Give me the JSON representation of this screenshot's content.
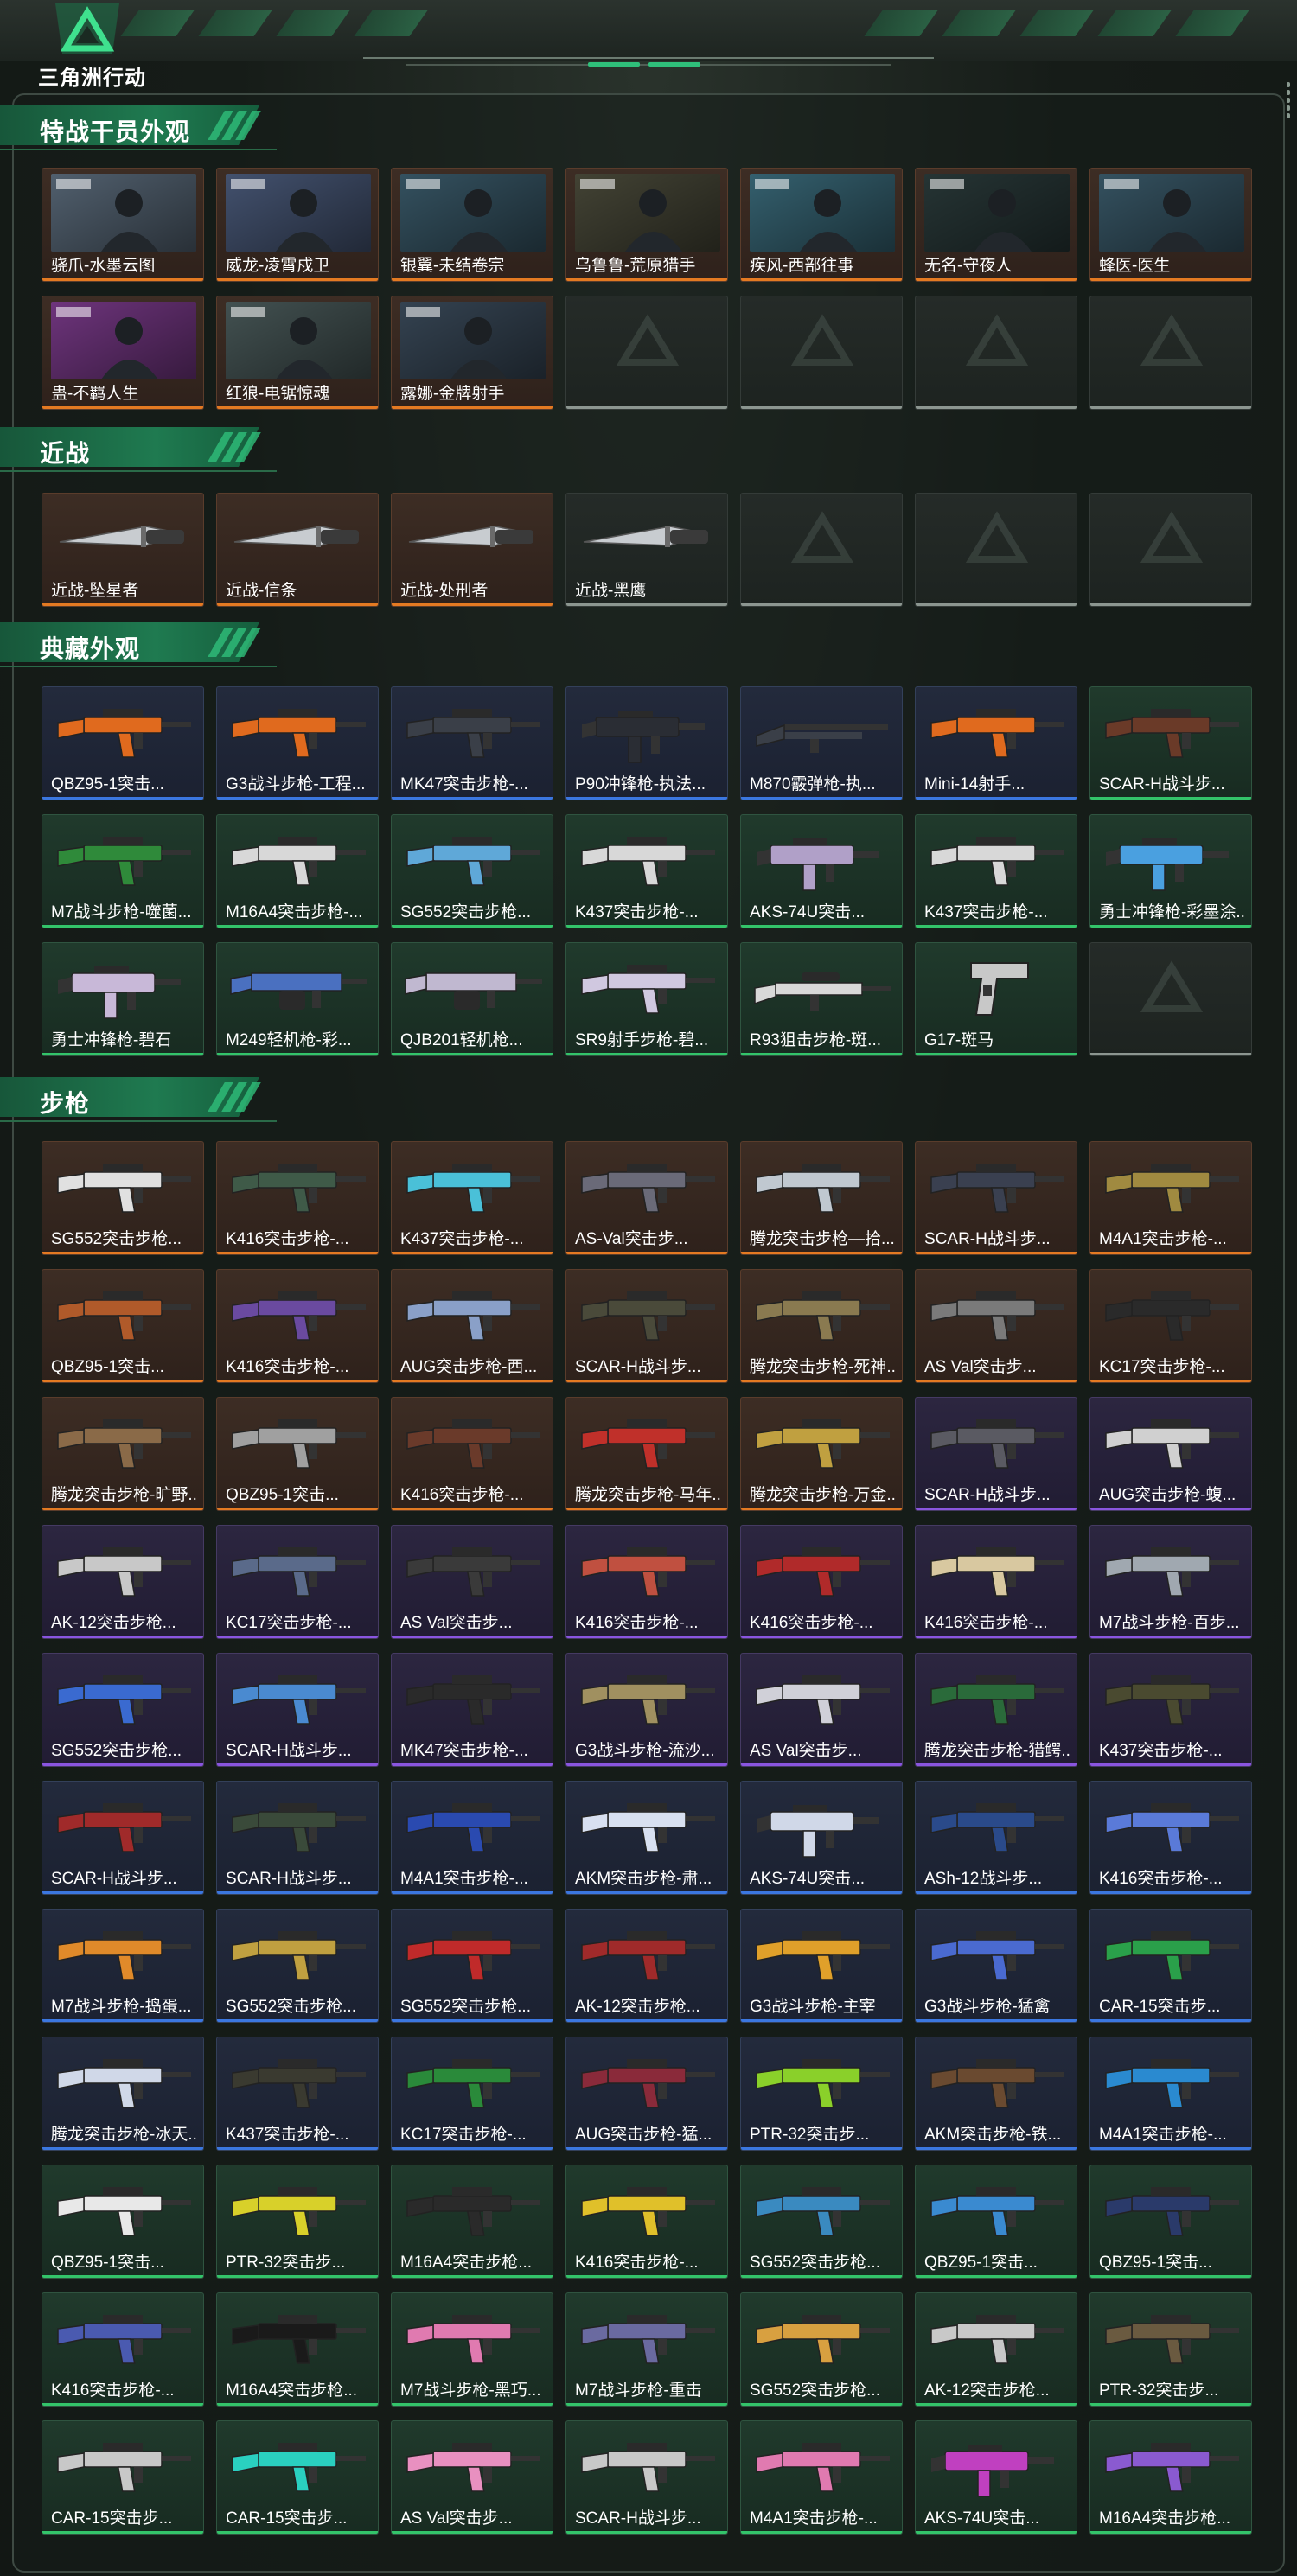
{
  "app": {
    "logo_text": "三角洲行动"
  },
  "colors": {
    "orange": "#e47a22",
    "blue": "#3b77e0",
    "purple": "#8a55e0",
    "green": "#33c46a",
    "accent": "#2fbf7a"
  },
  "sections": [
    {
      "title": "特战干员外观",
      "items": [
        {
          "name": "骁爪-水墨云图",
          "tier": "orange",
          "icon": "operator-portrait"
        },
        {
          "name": "威龙-凌霄戍卫",
          "tier": "orange",
          "icon": "operator-portrait"
        },
        {
          "name": "银翼-未结卷宗",
          "tier": "orange",
          "icon": "operator-portrait"
        },
        {
          "name": "乌鲁鲁-荒原猎手",
          "tier": "orange",
          "icon": "operator-portrait"
        },
        {
          "name": "疾风-西部往事",
          "tier": "orange",
          "icon": "operator-portrait"
        },
        {
          "name": "无名-守夜人",
          "tier": "orange",
          "icon": "operator-portrait"
        },
        {
          "name": "蜂医-医生",
          "tier": "orange",
          "icon": "operator-portrait"
        },
        {
          "name": "蛊-不羁人生",
          "tier": "orange",
          "icon": "operator-portrait"
        },
        {
          "name": "红狼-电锯惊魂",
          "tier": "orange",
          "icon": "operator-portrait"
        },
        {
          "name": "露娜-金牌射手",
          "tier": "orange",
          "icon": "operator-portrait"
        },
        {
          "name": "",
          "tier": "empty",
          "icon": "empty-slot"
        },
        {
          "name": "",
          "tier": "empty",
          "icon": "empty-slot"
        },
        {
          "name": "",
          "tier": "empty",
          "icon": "empty-slot"
        },
        {
          "name": "",
          "tier": "empty",
          "icon": "empty-slot"
        }
      ]
    },
    {
      "title": "近战",
      "items": [
        {
          "name": "近战-坠星者",
          "tier": "orange",
          "icon": "knife-icon"
        },
        {
          "name": "近战-信条",
          "tier": "orange",
          "icon": "knife-icon"
        },
        {
          "name": "近战-处刑者",
          "tier": "orange",
          "icon": "knife-icon"
        },
        {
          "name": "近战-黑鹰",
          "tier": "empty-dark",
          "icon": "knife-icon"
        },
        {
          "name": "",
          "tier": "empty",
          "icon": "empty-slot"
        },
        {
          "name": "",
          "tier": "empty",
          "icon": "empty-slot"
        },
        {
          "name": "",
          "tier": "empty",
          "icon": "empty-slot"
        }
      ]
    },
    {
      "title": "典藏外观",
      "items": [
        {
          "name": "QBZ95-1突击...",
          "tier": "blue",
          "icon": "rifle-icon",
          "tint": "#e06a1e"
        },
        {
          "name": "G3战斗步枪-工程...",
          "tier": "blue",
          "icon": "rifle-icon",
          "tint": "#e06a1e"
        },
        {
          "name": "MK47突击步枪-...",
          "tier": "blue",
          "icon": "rifle-icon",
          "tint": "#3a3f48"
        },
        {
          "name": "P90冲锋枪-执法...",
          "tier": "blue",
          "icon": "smg-icon",
          "tint": "#2a2d34"
        },
        {
          "name": "M870霰弹枪-执...",
          "tier": "blue",
          "icon": "shotgun-icon",
          "tint": "#3a3f48"
        },
        {
          "name": "Mini-14射手...",
          "tier": "blue",
          "icon": "rifle-icon",
          "tint": "#e06a1e"
        },
        {
          "name": "SCAR-H战斗步...",
          "tier": "green",
          "icon": "rifle-icon",
          "tint": "#6a3a28"
        },
        {
          "name": "M7战斗步枪-噬菌...",
          "tier": "green",
          "icon": "rifle-icon",
          "tint": "#2f8a3a"
        },
        {
          "name": "M16A4突击步枪-...",
          "tier": "green",
          "icon": "rifle-icon",
          "tint": "#d8d8d8"
        },
        {
          "name": "SG552突击步枪...",
          "tier": "green",
          "icon": "rifle-icon",
          "tint": "#5fa8d8"
        },
        {
          "name": "K437突击步枪-...",
          "tier": "green",
          "icon": "rifle-icon",
          "tint": "#d8d8d8"
        },
        {
          "name": "AKS-74U突击...",
          "tier": "green",
          "icon": "smg-icon",
          "tint": "#b0a0c8"
        },
        {
          "name": "K437突击步枪-...",
          "tier": "green",
          "icon": "rifle-icon",
          "tint": "#d8d8d8"
        },
        {
          "name": "勇士冲锋枪-彩墨涂...",
          "tier": "green",
          "icon": "smg-icon",
          "tint": "#4aa0e0"
        },
        {
          "name": "勇士冲锋枪-碧石",
          "tier": "green",
          "icon": "smg-icon",
          "tint": "#c8b8d8"
        },
        {
          "name": "M249轻机枪-彩...",
          "tier": "green",
          "icon": "lmg-icon",
          "tint": "#4a70c0"
        },
        {
          "name": "QJB201轻机枪...",
          "tier": "green",
          "icon": "lmg-icon",
          "tint": "#c0b8d0"
        },
        {
          "name": "SR9射手步枪-碧...",
          "tier": "green",
          "icon": "rifle-icon",
          "tint": "#d0c8e0"
        },
        {
          "name": "R93狙击步枪-斑...",
          "tier": "green",
          "icon": "sniper-icon",
          "tint": "#d8d8d8"
        },
        {
          "name": "G17-斑马",
          "tier": "green",
          "icon": "pistol-icon",
          "tint": "#c8c8c8"
        },
        {
          "name": "",
          "tier": "empty",
          "icon": "empty-slot"
        }
      ]
    },
    {
      "title": "步枪",
      "items": [
        {
          "name": "SG552突击步枪...",
          "tier": "orange",
          "icon": "rifle-icon",
          "tint": "#e0e0e0"
        },
        {
          "name": "K416突击步枪-...",
          "tier": "orange",
          "icon": "rifle-icon",
          "tint": "#3f5a48"
        },
        {
          "name": "K437突击步枪-...",
          "tier": "orange",
          "icon": "rifle-icon",
          "tint": "#4ac0d8"
        },
        {
          "name": "AS-Val突击步...",
          "tier": "orange",
          "icon": "rifle-icon",
          "tint": "#6a6a78"
        },
        {
          "name": "腾龙突击步枪—拾...",
          "tier": "orange",
          "icon": "rifle-icon",
          "tint": "#c0c8d0"
        },
        {
          "name": "SCAR-H战斗步...",
          "tier": "orange",
          "icon": "rifle-icon",
          "tint": "#3a4050"
        },
        {
          "name": "M4A1突击步枪-...",
          "tier": "orange",
          "icon": "rifle-icon",
          "tint": "#a08a40"
        },
        {
          "name": "QBZ95-1突击...",
          "tier": "orange",
          "icon": "rifle-icon",
          "tint": "#b05a2a"
        },
        {
          "name": "K416突击步枪-...",
          "tier": "orange",
          "icon": "rifle-icon",
          "tint": "#6a4aa0"
        },
        {
          "name": "AUG突击步枪-西...",
          "tier": "orange",
          "icon": "rifle-icon",
          "tint": "#8aa0c8"
        },
        {
          "name": "SCAR-H战斗步...",
          "tier": "orange",
          "icon": "rifle-icon",
          "tint": "#4a4a3a"
        },
        {
          "name": "腾龙突击步枪-死神...",
          "tier": "orange",
          "icon": "rifle-icon",
          "tint": "#8a7a50"
        },
        {
          "name": "AS Val突击步...",
          "tier": "orange",
          "icon": "rifle-icon",
          "tint": "#7a7a7a"
        },
        {
          "name": "KC17突击步枪-...",
          "tier": "orange",
          "icon": "rifle-icon",
          "tint": "#2a2a2a"
        },
        {
          "name": "腾龙突击步枪-旷野...",
          "tier": "orange",
          "icon": "rifle-icon",
          "tint": "#8a6a48"
        },
        {
          "name": "QBZ95-1突击...",
          "tier": "orange",
          "icon": "rifle-icon",
          "tint": "#a0a0a0"
        },
        {
          "name": "K416突击步枪-...",
          "tier": "orange",
          "icon": "rifle-icon",
          "tint": "#6a3a2a"
        },
        {
          "name": "腾龙突击步枪-马年...",
          "tier": "orange",
          "icon": "rifle-icon",
          "tint": "#c0302a"
        },
        {
          "name": "腾龙突击步枪-万金...",
          "tier": "orange",
          "icon": "rifle-icon",
          "tint": "#c0a040"
        },
        {
          "name": "SCAR-H战斗步...",
          "tier": "purple",
          "icon": "rifle-icon",
          "tint": "#5a5a62"
        },
        {
          "name": "AUG突击步枪-蝮...",
          "tier": "purple",
          "icon": "rifle-icon",
          "tint": "#d0d0d0"
        },
        {
          "name": "AK-12突击步枪...",
          "tier": "purple",
          "icon": "rifle-icon",
          "tint": "#c8c8c8"
        },
        {
          "name": "KC17突击步枪-...",
          "tier": "purple",
          "icon": "rifle-icon",
          "tint": "#5a6a8a"
        },
        {
          "name": "AS Val突击步...",
          "tier": "purple",
          "icon": "rifle-icon",
          "tint": "#3a3a3a"
        },
        {
          "name": "K416突击步枪-...",
          "tier": "purple",
          "icon": "rifle-icon",
          "tint": "#c05040"
        },
        {
          "name": "K416突击步枪-...",
          "tier": "purple",
          "icon": "rifle-icon",
          "tint": "#b02a2a"
        },
        {
          "name": "K416突击步枪-...",
          "tier": "purple",
          "icon": "rifle-icon",
          "tint": "#d8c8a0"
        },
        {
          "name": "M7战斗步枪-百步...",
          "tier": "purple",
          "icon": "rifle-icon",
          "tint": "#a0a8b0"
        },
        {
          "name": "SG552突击步枪...",
          "tier": "purple",
          "icon": "rifle-icon",
          "tint": "#3a6ad0"
        },
        {
          "name": "SCAR-H战斗步...",
          "tier": "purple",
          "icon": "rifle-icon",
          "tint": "#4a8ad0"
        },
        {
          "name": "MK47突击步枪-...",
          "tier": "purple",
          "icon": "rifle-icon",
          "tint": "#2a2a2a"
        },
        {
          "name": "G3战斗步枪-流沙...",
          "tier": "purple",
          "icon": "rifle-icon",
          "tint": "#a09060"
        },
        {
          "name": "AS Val突击步...",
          "tier": "purple",
          "icon": "rifle-icon",
          "tint": "#d0d0d8"
        },
        {
          "name": "腾龙突击步枪-猎鳄...",
          "tier": "purple",
          "icon": "rifle-icon",
          "tint": "#2a6a3a"
        },
        {
          "name": "K437突击步枪-...",
          "tier": "purple",
          "icon": "rifle-icon",
          "tint": "#4a4a30"
        },
        {
          "name": "SCAR-H战斗步...",
          "tier": "blue",
          "icon": "rifle-icon",
          "tint": "#a02a2a"
        },
        {
          "name": "SCAR-H战斗步...",
          "tier": "blue",
          "icon": "rifle-icon",
          "tint": "#3a4a3a"
        },
        {
          "name": "M4A1突击步枪-...",
          "tier": "blue",
          "icon": "rifle-icon",
          "tint": "#2a4ab0"
        },
        {
          "name": "AKM突击步枪-肃...",
          "tier": "blue",
          "icon": "rifle-icon",
          "tint": "#d8e0f0"
        },
        {
          "name": "AKS-74U突击...",
          "tier": "blue",
          "icon": "smg-icon",
          "tint": "#d0d8e8"
        },
        {
          "name": "ASh-12战斗步...",
          "tier": "blue",
          "icon": "rifle-icon",
          "tint": "#2a4a8a"
        },
        {
          "name": "K416突击步枪-...",
          "tier": "blue",
          "icon": "rifle-icon",
          "tint": "#5a7ad8"
        },
        {
          "name": "M7战斗步枪-捣蛋...",
          "tier": "blue",
          "icon": "rifle-icon",
          "tint": "#e08a2a"
        },
        {
          "name": "SG552突击步枪...",
          "tier": "blue",
          "icon": "rifle-icon",
          "tint": "#c0a040"
        },
        {
          "name": "SG552突击步枪...",
          "tier": "blue",
          "icon": "rifle-icon",
          "tint": "#c02a2a"
        },
        {
          "name": "AK-12突击步枪...",
          "tier": "blue",
          "icon": "rifle-icon",
          "tint": "#a02a2a"
        },
        {
          "name": "G3战斗步枪-主宰",
          "tier": "blue",
          "icon": "rifle-icon",
          "tint": "#e0a02a"
        },
        {
          "name": "G3战斗步枪-猛禽",
          "tier": "blue",
          "icon": "rifle-icon",
          "tint": "#4a6ad0"
        },
        {
          "name": "CAR-15突击步...",
          "tier": "blue",
          "icon": "rifle-icon",
          "tint": "#2aa04a"
        },
        {
          "name": "腾龙突击步枪-冰天...",
          "tier": "blue",
          "icon": "rifle-icon",
          "tint": "#d0d8e8"
        },
        {
          "name": "K437突击步枪-...",
          "tier": "blue",
          "icon": "rifle-icon",
          "tint": "#3a3a30"
        },
        {
          "name": "KC17突击步枪-...",
          "tier": "blue",
          "icon": "rifle-icon",
          "tint": "#2a8a3a"
        },
        {
          "name": "AUG突击步枪-猛...",
          "tier": "blue",
          "icon": "rifle-icon",
          "tint": "#8a2a3a"
        },
        {
          "name": "PTR-32突击步...",
          "tier": "blue",
          "icon": "rifle-icon",
          "tint": "#8ad02a"
        },
        {
          "name": "AKM突击步枪-铁...",
          "tier": "blue",
          "icon": "rifle-icon",
          "tint": "#6a4a30"
        },
        {
          "name": "M4A1突击步枪-...",
          "tier": "blue",
          "icon": "rifle-icon",
          "tint": "#2a8ad0"
        },
        {
          "name": "QBZ95-1突击...",
          "tier": "green",
          "icon": "rifle-icon",
          "tint": "#e8e8e8"
        },
        {
          "name": "PTR-32突击步...",
          "tier": "green",
          "icon": "rifle-icon",
          "tint": "#d8d02a"
        },
        {
          "name": "M16A4突击步枪...",
          "tier": "green",
          "icon": "rifle-icon",
          "tint": "#2a2a2a"
        },
        {
          "name": "K416突击步枪-...",
          "tier": "green",
          "icon": "rifle-icon",
          "tint": "#e0c02a"
        },
        {
          "name": "SG552突击步枪...",
          "tier": "green",
          "icon": "rifle-icon",
          "tint": "#3a8ac0"
        },
        {
          "name": "QBZ95-1突击...",
          "tier": "green",
          "icon": "rifle-icon",
          "tint": "#3a8ad0"
        },
        {
          "name": "QBZ95-1突击...",
          "tier": "green",
          "icon": "rifle-icon",
          "tint": "#2a3a6a"
        },
        {
          "name": "K416突击步枪-...",
          "tier": "green",
          "icon": "rifle-icon",
          "tint": "#4a5ab0"
        },
        {
          "name": "M16A4突击步枪...",
          "tier": "green",
          "icon": "rifle-icon",
          "tint": "#1a1a1a"
        },
        {
          "name": "M7战斗步枪-黑巧...",
          "tier": "green",
          "icon": "rifle-icon",
          "tint": "#e07ab0"
        },
        {
          "name": "M7战斗步枪-重击",
          "tier": "green",
          "icon": "rifle-icon",
          "tint": "#6a6aa0"
        },
        {
          "name": "SG552突击步枪...",
          "tier": "green",
          "icon": "rifle-icon",
          "tint": "#d8a040"
        },
        {
          "name": "AK-12突击步枪...",
          "tier": "green",
          "icon": "rifle-icon",
          "tint": "#c8c8c8"
        },
        {
          "name": "PTR-32突击步...",
          "tier": "green",
          "icon": "rifle-icon",
          "tint": "#6a5a40"
        },
        {
          "name": "CAR-15突击步...",
          "tier": "green",
          "icon": "rifle-icon",
          "tint": "#c8c8c8"
        },
        {
          "name": "CAR-15突击步...",
          "tier": "green",
          "icon": "rifle-icon",
          "tint": "#2ad0c0"
        },
        {
          "name": "AS Val突击步...",
          "tier": "green",
          "icon": "rifle-icon",
          "tint": "#e890c0"
        },
        {
          "name": "SCAR-H战斗步...",
          "tier": "green",
          "icon": "rifle-icon",
          "tint": "#c8c8c8"
        },
        {
          "name": "M4A1突击步枪-...",
          "tier": "green",
          "icon": "rifle-icon",
          "tint": "#e07ab0"
        },
        {
          "name": "AKS-74U突击...",
          "tier": "green",
          "icon": "smg-icon",
          "tint": "#c040c0"
        },
        {
          "name": "M16A4突击步枪...",
          "tier": "green",
          "icon": "rifle-icon",
          "tint": "#8a5ad0"
        }
      ]
    }
  ]
}
